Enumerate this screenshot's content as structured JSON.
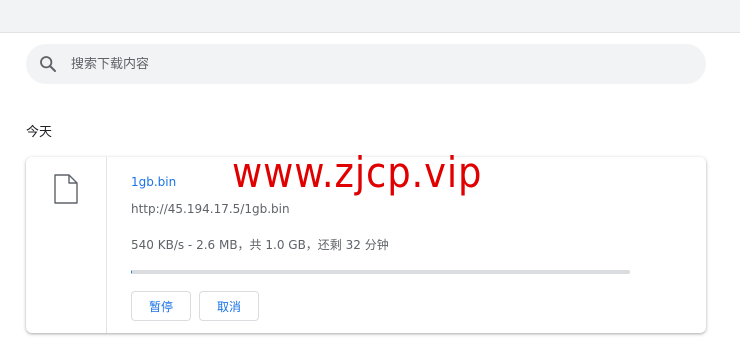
{
  "search": {
    "placeholder": "搜索下载内容",
    "icon": "search-icon"
  },
  "section": {
    "date_label": "今天"
  },
  "download": {
    "file_icon": "file-icon",
    "file_name": "1gb.bin",
    "url": "http://45.194.17.5/1gb.bin",
    "status": "540 KB/s - 2.6 MB，共 1.0 GB，还剩 32 分钟",
    "progress_fraction": 0.0026,
    "pause_label": "暂停",
    "cancel_label": "取消"
  },
  "watermark": {
    "text": "www.zjcp.vip"
  },
  "colors": {
    "accent": "#1a73e8",
    "watermark": "#e00000",
    "track": "#dadce0"
  }
}
